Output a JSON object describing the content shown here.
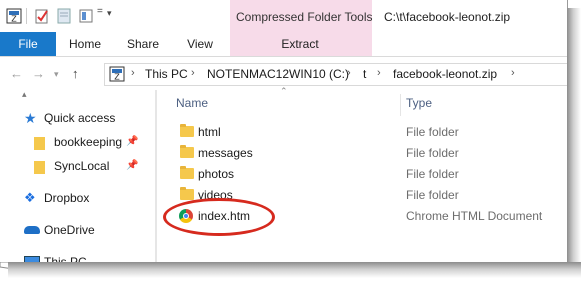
{
  "window": {
    "title": "C:\\t\\facebook-leonot.zip",
    "context_tab_group": "Compressed Folder Tools"
  },
  "ribbon": {
    "tabs": [
      "File",
      "Home",
      "Share",
      "View"
    ],
    "context_tab": "Extract"
  },
  "address": {
    "crumbs": [
      "This PC",
      "NOTENMAC12WIN10 (C:)",
      "t",
      "facebook-leonot.zip"
    ]
  },
  "nav": {
    "items": [
      {
        "label": "Quick access"
      },
      {
        "label": "bookkeeping"
      },
      {
        "label": "SyncLocal"
      },
      {
        "label": "Dropbox"
      },
      {
        "label": "OneDrive"
      },
      {
        "label": "This PC"
      }
    ]
  },
  "columns": {
    "name": "Name",
    "type": "Type"
  },
  "files": [
    {
      "name": "html",
      "type": "File folder"
    },
    {
      "name": "messages",
      "type": "File folder"
    },
    {
      "name": "photos",
      "type": "File folder"
    },
    {
      "name": "videos",
      "type": "File folder"
    },
    {
      "name": "index.htm",
      "type": "Chrome HTML Document"
    }
  ],
  "colors": {
    "file_tab": "#1979ca",
    "context_tab": "#f7dbe9",
    "highlight_ellipse": "#d62a1e",
    "folder": "#f5c84c"
  },
  "icons": [
    "save-icon",
    "properties-icon",
    "new-folder-icon",
    "customize-qa-icon",
    "back-icon",
    "forward-icon",
    "up-icon",
    "star-icon",
    "folder-icon",
    "pin-icon",
    "dropbox-icon",
    "onedrive-icon",
    "pc-icon",
    "chrome-icon"
  ]
}
